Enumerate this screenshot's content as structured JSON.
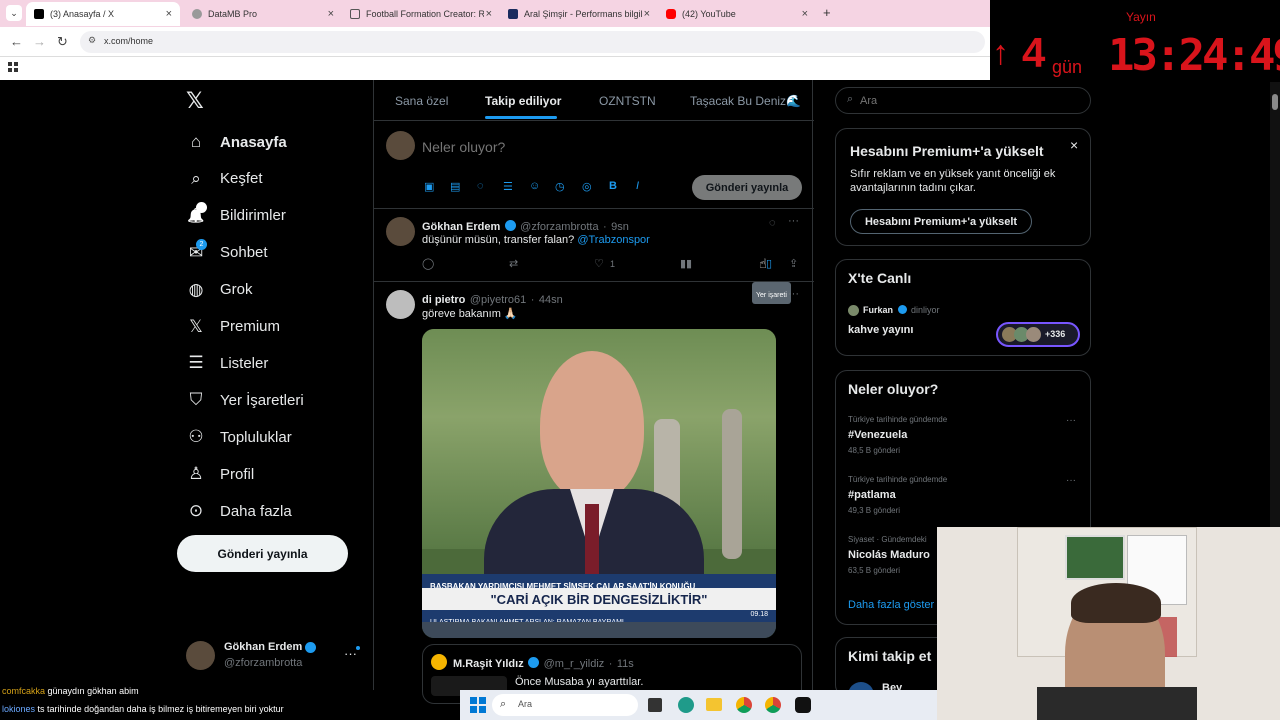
{
  "browser": {
    "tabs": [
      {
        "title": "(3) Anasayfa / X",
        "active": true,
        "color": "#000000"
      },
      {
        "title": "DataMB Pro",
        "active": false,
        "color": "#888888"
      },
      {
        "title": "Football Formation Creator: Re",
        "active": false,
        "color": "#555555"
      },
      {
        "title": "Aral Şimşir - Performans bilgile",
        "active": false,
        "color": "#1a2b5e"
      },
      {
        "title": "(42) YouTube",
        "active": false,
        "color": "#ff0000"
      }
    ],
    "new_tab": "+",
    "url": "x.com/home"
  },
  "overlay": {
    "label": "Yayın",
    "days_number": "4",
    "days_unit": "gün",
    "clock": "13:24:49",
    "color": "#d9141b"
  },
  "nav": {
    "items": [
      {
        "label": "Anasayfa",
        "icon": "home-icon"
      },
      {
        "label": "Keşfet",
        "icon": "search-icon"
      },
      {
        "label": "Bildirimler",
        "icon": "bell-icon",
        "badge": "1"
      },
      {
        "label": "Sohbet",
        "icon": "mail-icon",
        "badge": "2"
      },
      {
        "label": "Grok",
        "icon": "grok-icon"
      },
      {
        "label": "Premium",
        "icon": "x-logo-icon"
      },
      {
        "label": "Listeler",
        "icon": "list-icon"
      },
      {
        "label": "Yer İşaretleri",
        "icon": "bookmark-icon"
      },
      {
        "label": "Topluluklar",
        "icon": "people-icon"
      },
      {
        "label": "Profil",
        "icon": "person-icon"
      },
      {
        "label": "Daha fazla",
        "icon": "more-circle-icon"
      }
    ],
    "post_button": "Gönderi yayınla",
    "account": {
      "name": "Gökhan Erdem",
      "handle": "@zforzambrotta",
      "more": "···"
    }
  },
  "timeline": {
    "tabs": [
      "Sana özel",
      "Takip ediliyor",
      "OZNTSTN",
      "Taşacak Bu Deniz🌊"
    ],
    "active_tab": 1,
    "composer": {
      "placeholder": "Neler oluyor?",
      "button": "Gönderi yayınla"
    },
    "tweets": [
      {
        "name": "Gökhan Erdem",
        "handle": "@zforzambrotta",
        "time": "9sn",
        "text": "düşünür müsün, transfer falan?",
        "mention": "@Trabzonspor",
        "likes": "1",
        "tooltip": "Yer işareti"
      },
      {
        "name": "di pietro",
        "handle": "@piyetro61",
        "time": "44sn",
        "text": "göreve bakanım 🙏🏻",
        "image": {
          "banner_top": "BAŞBAKAN YARDIMCISI MEHMET ŞİMŞEK ÇALAR SAAT'İN KONUĞU",
          "banner_main": "\"CARİ AÇIK BİR DENGESİZLİKTİR\"",
          "banner_bottom": "ULAŞTIRMA BAKANI AHMET ARSLAN: RAMAZAN BAYRAMI",
          "banner_time": "09.18"
        },
        "quote": {
          "name": "M.Raşit Yıldız",
          "handle": "@m_r_yildiz",
          "time": "11s",
          "text": "Önce Musaba yı ayarttılar."
        }
      }
    ]
  },
  "sidebar": {
    "search_placeholder": "Ara",
    "premium": {
      "title": "Hesabını Premium+'a yükselt",
      "body": "Sıfır reklam ve en yüksek yanıt önceliği ek avantajlarının tadını çıkar.",
      "button": "Hesabını Premium+'a yükselt",
      "close": "×"
    },
    "live": {
      "title": "X'te Canlı",
      "host": "Furkan",
      "status": "dinliyor",
      "topic": "kahve yayını",
      "count": "+336"
    },
    "trends": {
      "title": "Neler oluyor?",
      "items": [
        {
          "meta": "Türkiye tarihinde gündemde",
          "name": "#Venezuela",
          "count": "48,5 B gönderi"
        },
        {
          "meta": "Türkiye tarihinde gündemde",
          "name": "#patlama",
          "count": "49,3 B gönderi"
        },
        {
          "meta": "Siyaset · Gündemdeki",
          "name": "Nicolás Maduro",
          "count": "63,5 B gönderi"
        }
      ],
      "show_more": "Daha fazla göster"
    },
    "follow": {
      "title": "Kimi takip et",
      "partial": "Bey"
    }
  },
  "chat": [
    {
      "user": "comfcakka",
      "text": "günaydın gökhan abim"
    },
    {
      "user": "lokiones",
      "text": "ts tarihinde doğandan daha iş bilmez iş bitiremeyen biri yoktur"
    }
  ],
  "taskbar": {
    "search_label": "Ara"
  }
}
